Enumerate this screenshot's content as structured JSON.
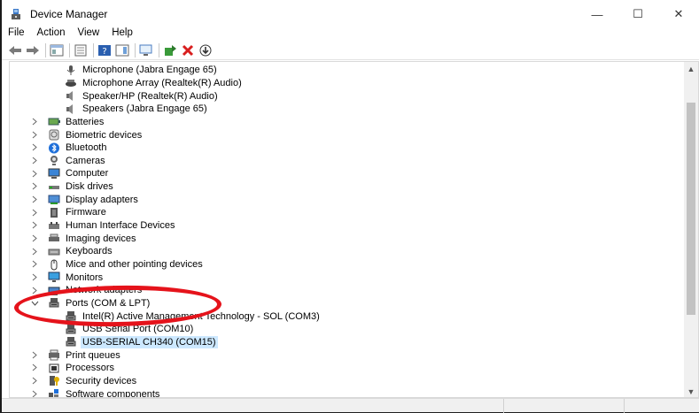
{
  "window": {
    "title": "Device Manager"
  },
  "controls": {
    "minimize": "—",
    "maximize": "☐",
    "close": "✕"
  },
  "menu": [
    "File",
    "Action",
    "View",
    "Help"
  ],
  "tree": [
    {
      "label": "Microphone (Jabra Engage 65)",
      "level": 2,
      "icon": "microphone-icon"
    },
    {
      "label": "Microphone Array (Realtek(R) Audio)",
      "level": 2,
      "icon": "microphone-array-icon"
    },
    {
      "label": "Speaker/HP (Realtek(R) Audio)",
      "level": 2,
      "icon": "speaker-icon"
    },
    {
      "label": "Speakers (Jabra Engage 65)",
      "level": 2,
      "icon": "speaker-icon"
    },
    {
      "label": "Batteries",
      "level": 1,
      "icon": "battery-icon",
      "expander": "collapsed"
    },
    {
      "label": "Biometric devices",
      "level": 1,
      "icon": "biometric-icon",
      "expander": "collapsed"
    },
    {
      "label": "Bluetooth",
      "level": 1,
      "icon": "bluetooth-icon",
      "expander": "collapsed"
    },
    {
      "label": "Cameras",
      "level": 1,
      "icon": "camera-icon",
      "expander": "collapsed"
    },
    {
      "label": "Computer",
      "level": 1,
      "icon": "computer-icon",
      "expander": "collapsed"
    },
    {
      "label": "Disk drives",
      "level": 1,
      "icon": "disk-drive-icon",
      "expander": "collapsed"
    },
    {
      "label": "Display adapters",
      "level": 1,
      "icon": "display-adapter-icon",
      "expander": "collapsed"
    },
    {
      "label": "Firmware",
      "level": 1,
      "icon": "firmware-icon",
      "expander": "collapsed"
    },
    {
      "label": "Human Interface Devices",
      "level": 1,
      "icon": "hid-icon",
      "expander": "collapsed"
    },
    {
      "label": "Imaging devices",
      "level": 1,
      "icon": "imaging-icon",
      "expander": "collapsed"
    },
    {
      "label": "Keyboards",
      "level": 1,
      "icon": "keyboard-icon",
      "expander": "collapsed"
    },
    {
      "label": "Mice and other pointing devices",
      "level": 1,
      "icon": "mouse-icon",
      "expander": "collapsed"
    },
    {
      "label": "Monitors",
      "level": 1,
      "icon": "monitor-icon",
      "expander": "collapsed"
    },
    {
      "label": "Network adapters",
      "level": 1,
      "icon": "network-icon",
      "expander": "collapsed"
    },
    {
      "label": "Ports (COM & LPT)",
      "level": 1,
      "icon": "port-icon",
      "expander": "expanded"
    },
    {
      "label": "Intel(R) Active Management Technology - SOL (COM3)",
      "level": 2,
      "icon": "port-icon"
    },
    {
      "label": "USB Serial Port (COM10)",
      "level": 2,
      "icon": "port-icon"
    },
    {
      "label": "USB-SERIAL CH340 (COM15)",
      "level": 2,
      "icon": "port-icon",
      "selected": true
    },
    {
      "label": "Print queues",
      "level": 1,
      "icon": "printer-icon",
      "expander": "collapsed"
    },
    {
      "label": "Processors",
      "level": 1,
      "icon": "processor-icon",
      "expander": "collapsed"
    },
    {
      "label": "Security devices",
      "level": 1,
      "icon": "security-icon",
      "expander": "collapsed"
    },
    {
      "label": "Software components",
      "level": 1,
      "icon": "software-icon",
      "expander": "collapsed"
    }
  ],
  "colors": {
    "selection": "#cce8ff",
    "annotation": "#e5131b"
  }
}
